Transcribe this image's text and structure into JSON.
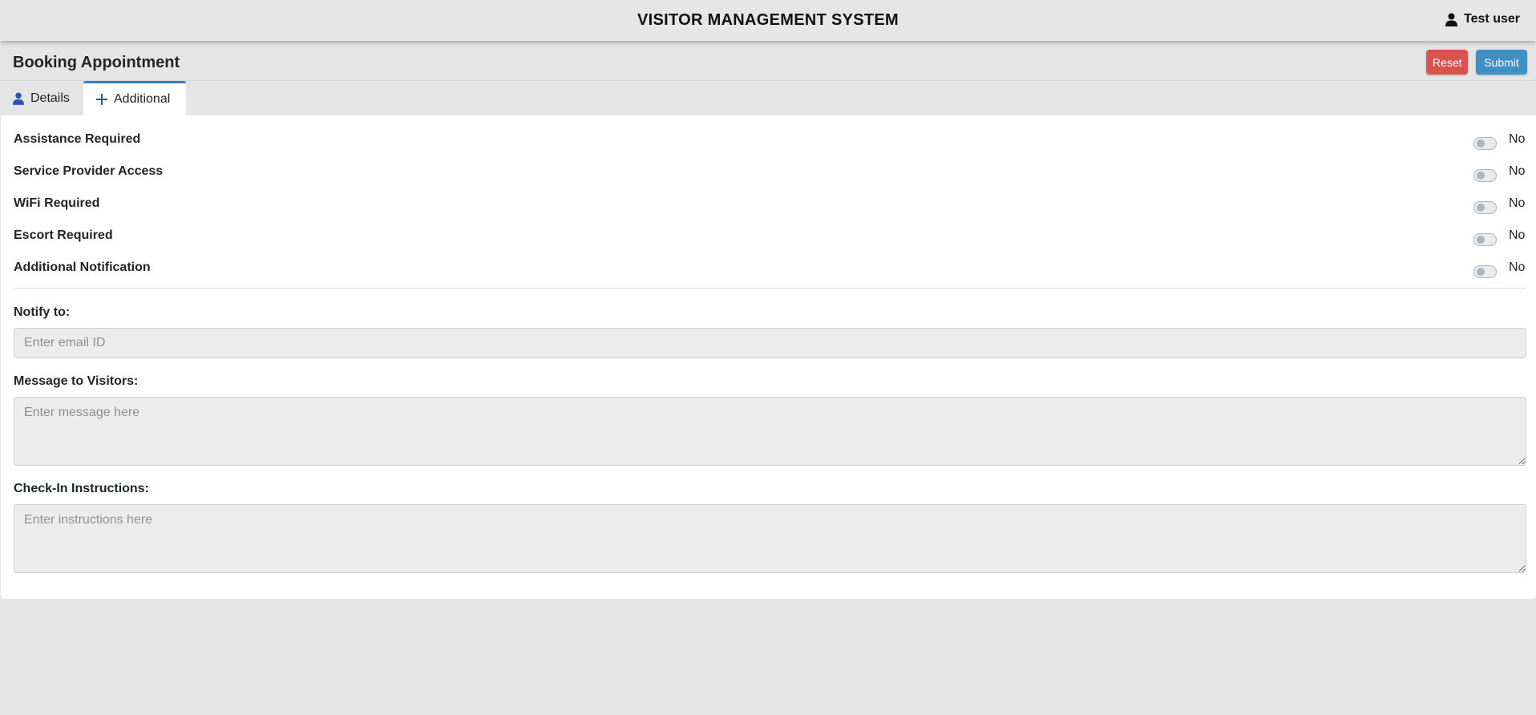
{
  "header": {
    "app_title": "VISITOR MANAGEMENT SYSTEM",
    "user_name": "Test user",
    "user_icon": "user-icon"
  },
  "page": {
    "title": "Booking Appointment",
    "reset_label": "Reset",
    "submit_label": "Submit",
    "reset_color": "#d9534f",
    "submit_color": "#3d8fc5"
  },
  "tabs": [
    {
      "label": "Details",
      "icon": "user-icon",
      "active": false
    },
    {
      "label": "Additional",
      "icon": "plus-icon",
      "active": true
    }
  ],
  "toggles": [
    {
      "label": "Assistance Required",
      "state": "No"
    },
    {
      "label": "Service Provider Access",
      "state": "No"
    },
    {
      "label": "WiFi Required",
      "state": "No"
    },
    {
      "label": "Escort Required",
      "state": "No"
    },
    {
      "label": "Additional Notification",
      "state": "No"
    }
  ],
  "notify": {
    "label": "Notify to:",
    "placeholder": "Enter email ID",
    "value": ""
  },
  "message": {
    "label": "Message to Visitors:",
    "placeholder": "Enter message here",
    "value": ""
  },
  "checkin": {
    "label": "Check-In Instructions:",
    "placeholder": "Enter instructions here",
    "value": ""
  }
}
